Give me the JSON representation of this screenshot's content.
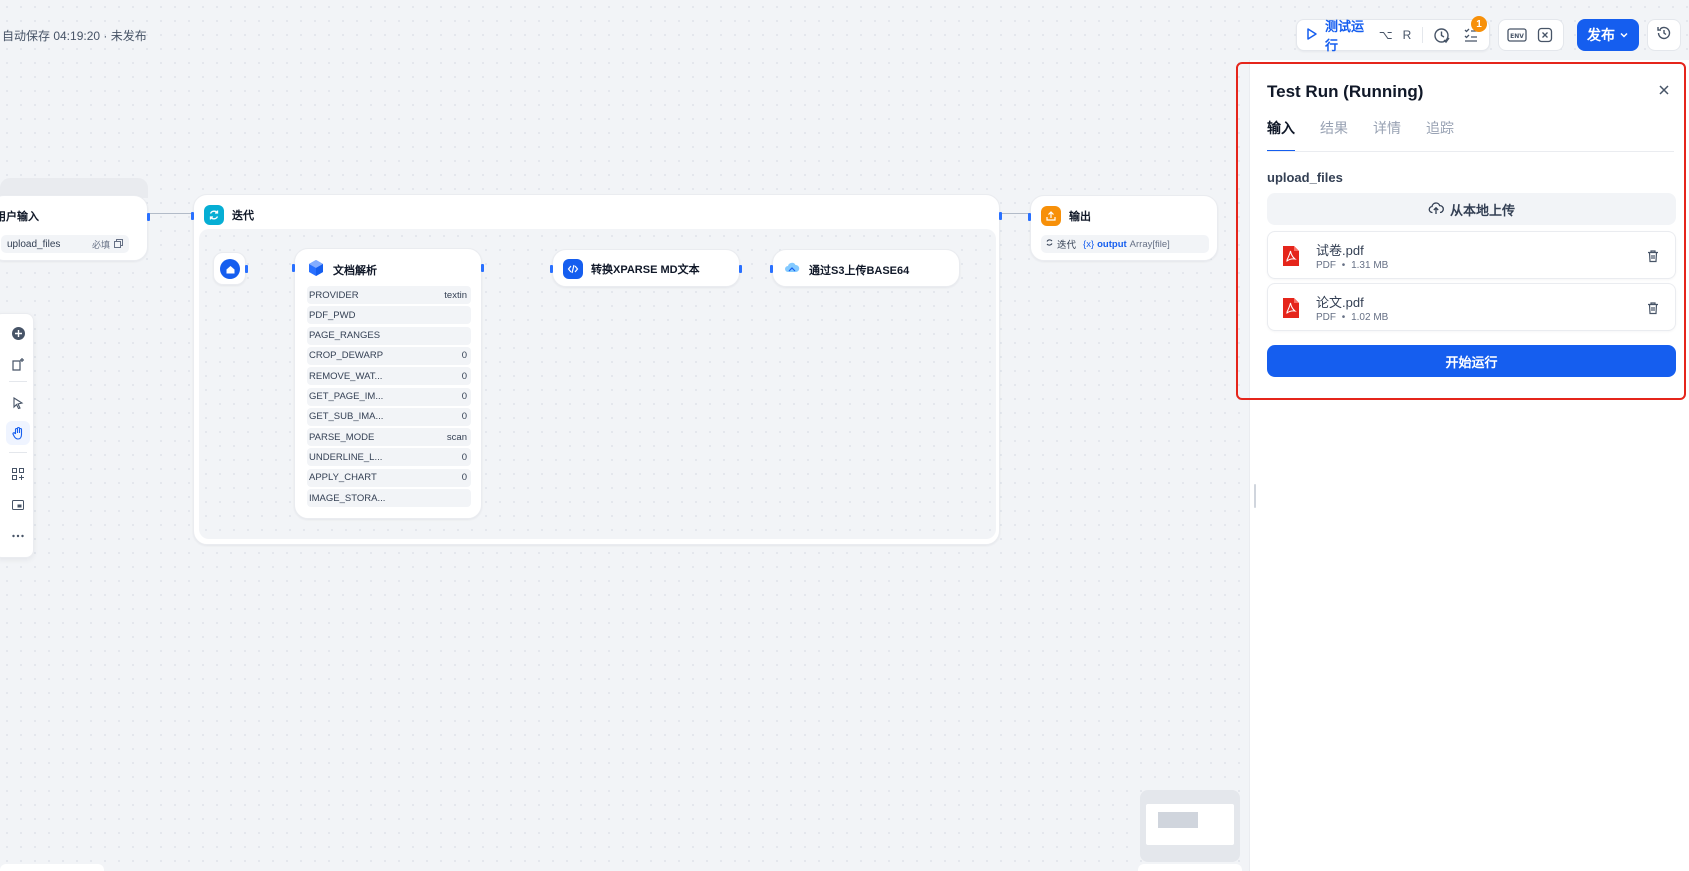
{
  "header": {
    "autosave_status": "自动保存 04:19:20 · 未发布",
    "test_run_label": "测试运行",
    "shortcut_alt": "⌥",
    "shortcut_key": "R",
    "checklist_badge": "1",
    "publish_label": "发布"
  },
  "nodes": {
    "start": {
      "title": "用户输入",
      "var_name": "upload_files",
      "var_required": "必填"
    },
    "iteration": {
      "title": "迭代"
    },
    "doc_parse": {
      "title": "文档解析",
      "params": [
        {
          "name": "PROVIDER",
          "value": "textin"
        },
        {
          "name": "PDF_PWD",
          "value": ""
        },
        {
          "name": "PAGE_RANGES",
          "value": ""
        },
        {
          "name": "CROP_DEWARP",
          "value": "0"
        },
        {
          "name": "REMOVE_WAT...",
          "value": "0"
        },
        {
          "name": "GET_PAGE_IM...",
          "value": "0"
        },
        {
          "name": "GET_SUB_IMA...",
          "value": "0"
        },
        {
          "name": "PARSE_MODE",
          "value": "scan"
        },
        {
          "name": "UNDERLINE_L...",
          "value": "0"
        },
        {
          "name": "APPLY_CHART",
          "value": "0"
        },
        {
          "name": "IMAGE_STORA...",
          "value": ""
        }
      ]
    },
    "xparse": {
      "title": "转换XPARSE MD文本"
    },
    "s3": {
      "title": "通过S3上传BASE64"
    },
    "output": {
      "title": "输出",
      "var_source": "迭代",
      "var_marker": "{x}",
      "var_name": "output",
      "var_type": "Array[file]"
    }
  },
  "panel": {
    "title": "Test Run (Running)",
    "tabs": [
      {
        "label": "输入",
        "active": true
      },
      {
        "label": "结果",
        "active": false
      },
      {
        "label": "详情",
        "active": false
      },
      {
        "label": "追踪",
        "active": false
      }
    ],
    "field_label": "upload_files",
    "upload_label": "从本地上传",
    "files": [
      {
        "name": "试卷.pdf",
        "type": "PDF",
        "size": "1.31 MB"
      },
      {
        "name": "论文.pdf",
        "type": "PDF",
        "size": "1.02 MB"
      }
    ],
    "run_label": "开始运行"
  },
  "colors": {
    "accent": "#155eef",
    "highlight": "#e5251b",
    "pdf": "#e5251b",
    "iteration": "#06aed4",
    "output": "#f79009"
  },
  "icons": [
    "play-icon",
    "checkup-icon",
    "checklist-icon",
    "env-icon",
    "variable-icon",
    "chevron-down-icon",
    "history-icon",
    "close-icon",
    "upload-cloud-icon",
    "pdf-file-icon",
    "trash-icon"
  ]
}
